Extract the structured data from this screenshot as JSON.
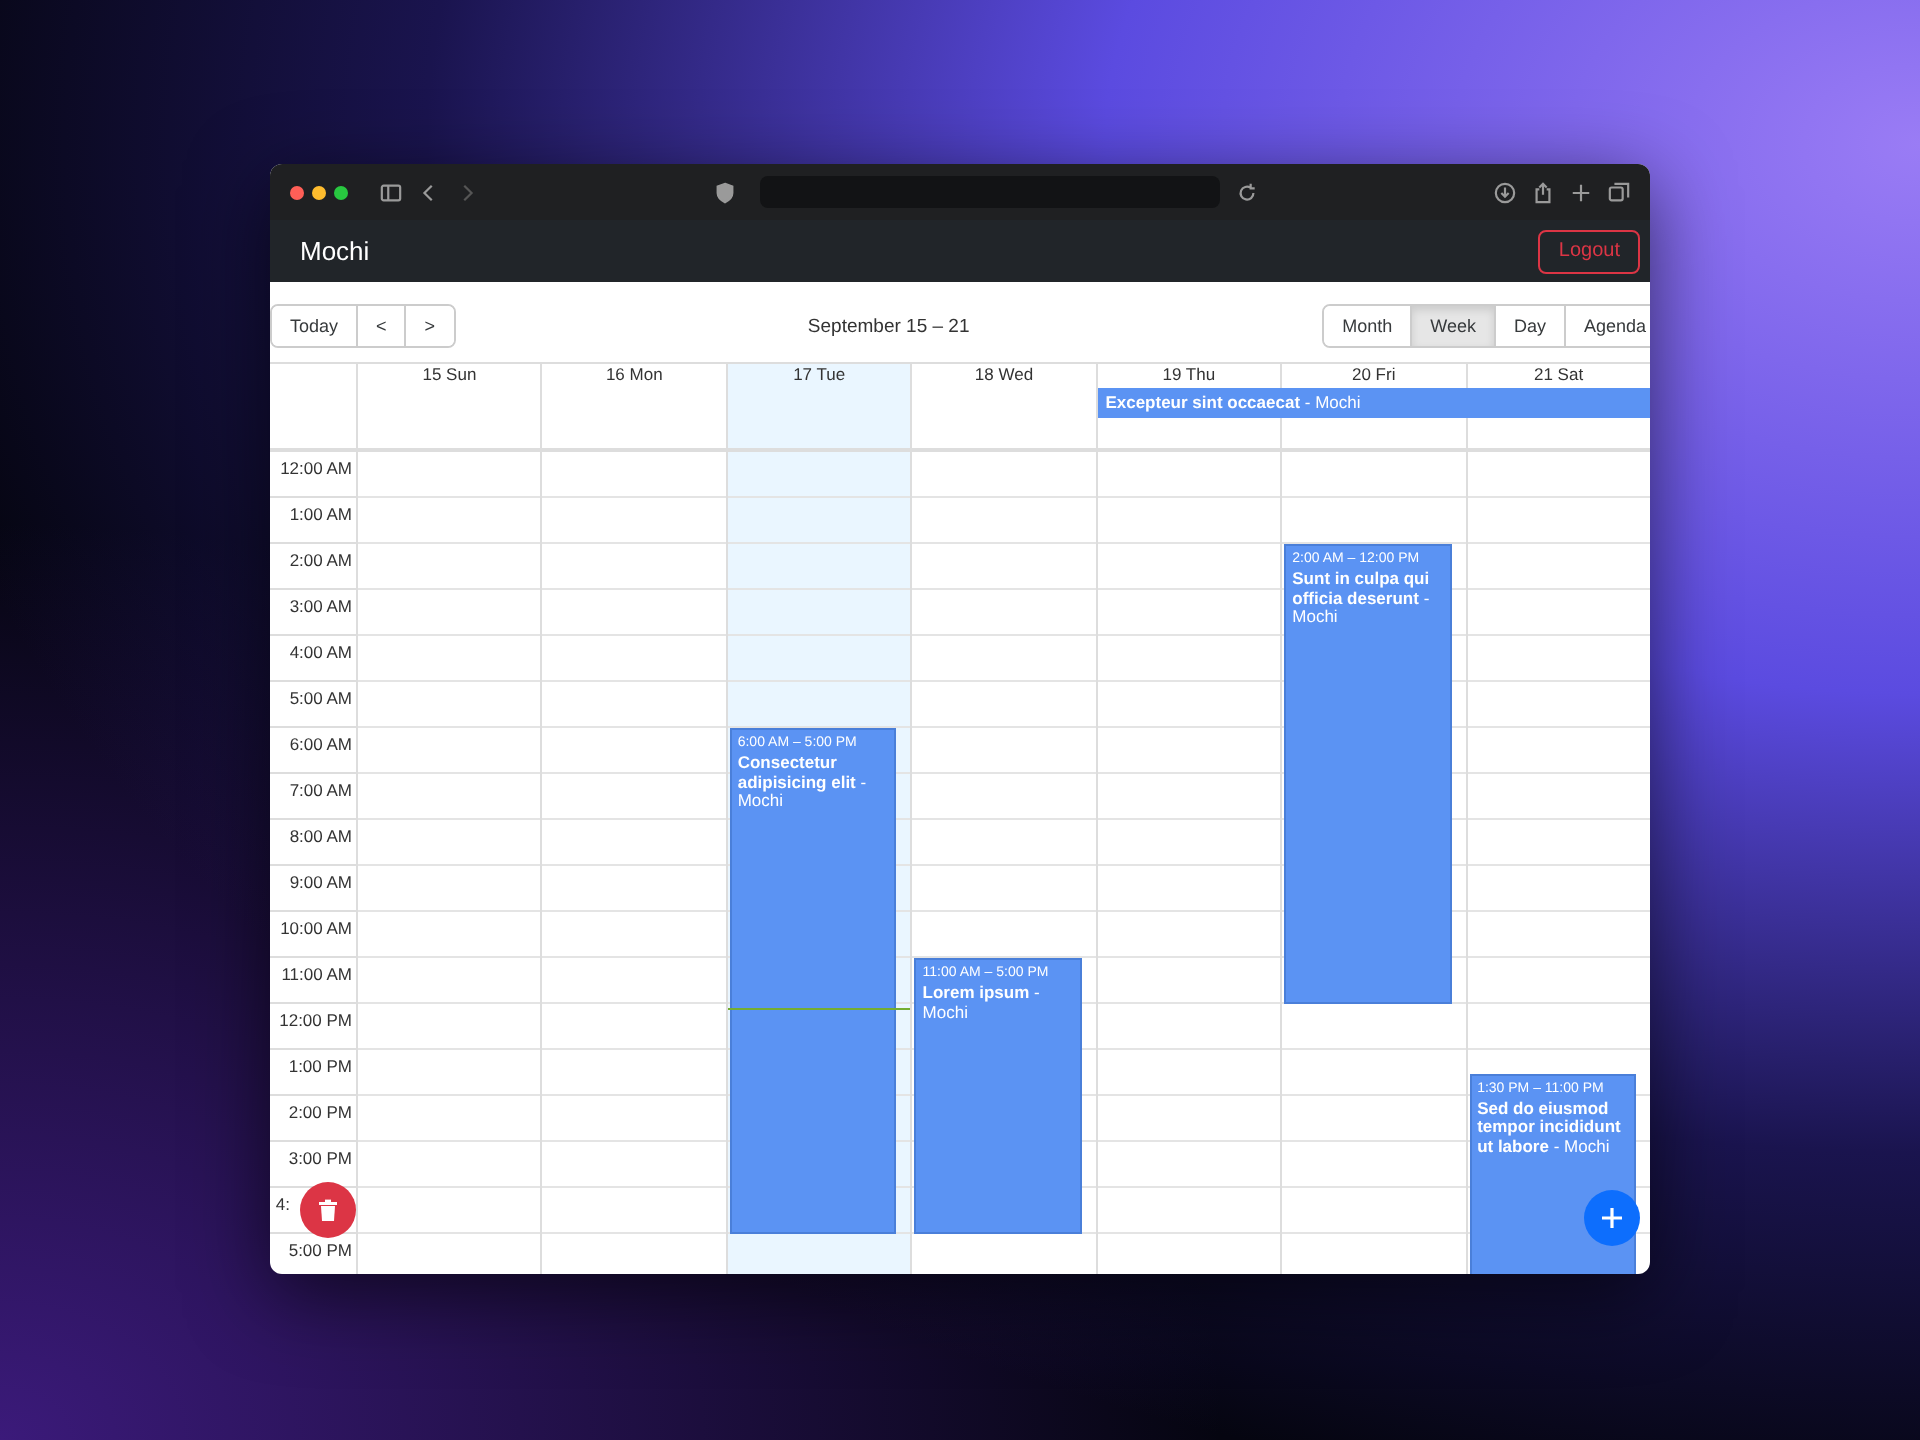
{
  "app": {
    "brand": "Mochi",
    "logout": "Logout"
  },
  "toolbar": {
    "today": "Today",
    "prev": "<",
    "next": ">",
    "range": "September 15 – 21",
    "views": [
      {
        "label": "Month",
        "selected": false
      },
      {
        "label": "Week",
        "selected": true
      },
      {
        "label": "Day",
        "selected": false
      },
      {
        "label": "Agenda",
        "selected": false
      }
    ]
  },
  "days": [
    {
      "label": "15 Sun",
      "today": false
    },
    {
      "label": "16 Mon",
      "today": false
    },
    {
      "label": "17 Tue",
      "today": true,
      "events": [
        {
          "time": "6:00 AM – 5:00 PM",
          "title": "Consectetur adipisicing elit",
          "calendar": "- Mochi"
        }
      ]
    },
    {
      "label": "18 Wed",
      "today": false,
      "events": [
        {
          "time": "11:00 AM – 5:00 PM",
          "title": "Lorem ipsum",
          "calendar": "- Mochi"
        }
      ]
    },
    {
      "label": "19 Thu",
      "today": false,
      "allday": [
        {
          "title": "Excepteur sint occaecat",
          "calendar": "- Mochi"
        }
      ]
    },
    {
      "label": "20 Fri",
      "today": false,
      "events": [
        {
          "time": "2:00 AM – 12:00 PM",
          "title": "Sunt in culpa qui officia deserunt",
          "calendar": "- Mochi"
        }
      ]
    },
    {
      "label": "21 Sat",
      "today": false,
      "events": [
        {
          "time": "1:30 PM – 11:00 PM",
          "title": "Sed do eiusmod tempor incididunt ut labore",
          "calendar": "- Mochi"
        }
      ]
    }
  ],
  "hours": [
    "12:00 AM",
    "1:00 AM",
    "2:00 AM",
    "3:00 AM",
    "4:00 AM",
    "5:00 AM",
    "6:00 AM",
    "7:00 AM",
    "8:00 AM",
    "9:00 AM",
    "10:00 AM",
    "11:00 AM",
    "12:00 PM",
    "1:00 PM",
    "2:00 PM",
    "3:00 PM",
    "4:",
    "5:00 PM"
  ]
}
